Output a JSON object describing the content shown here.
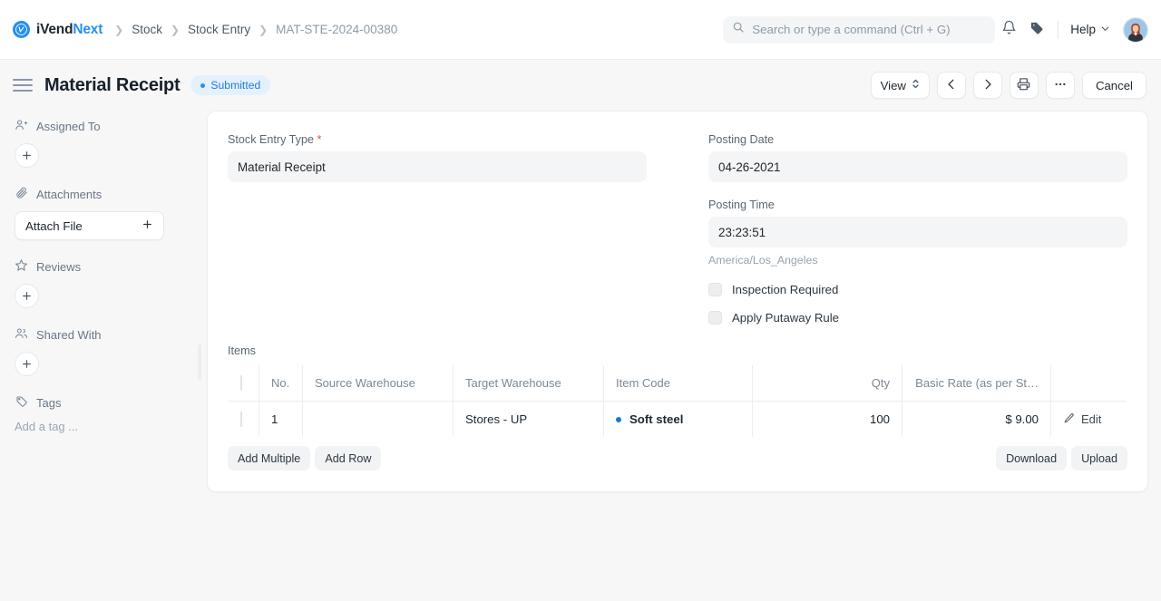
{
  "navbar": {
    "brand": {
      "part1": "iVend",
      "part2": "Next",
      "logo_icon": "ivend-logo-icon"
    },
    "breadcrumbs": [
      {
        "label": "Stock"
      },
      {
        "label": "Stock Entry"
      },
      {
        "label": "MAT-STE-2024-00380"
      }
    ],
    "search": {
      "placeholder": "Search or type a command (Ctrl + G)",
      "value": "",
      "icon": "search-icon"
    },
    "notifications_icon": "bell-icon",
    "tags_icon": "tag-icon",
    "help": {
      "label": "Help",
      "chevron": "chevron-down-icon"
    },
    "avatar_alt": "user-avatar"
  },
  "titlebar": {
    "menu_icon": "hamburger-icon",
    "title": "Material Receipt",
    "status": {
      "label": "Submitted",
      "color": "#2490ef",
      "bg": "#e5f0fd"
    },
    "actions": {
      "view_label": "View",
      "view_icon": "chevron-up-down-icon",
      "prev_icon": "chevron-left-icon",
      "next_icon": "chevron-right-icon",
      "print_icon": "printer-icon",
      "more_icon": "ellipsis-icon",
      "cancel_label": "Cancel"
    }
  },
  "sidebar": {
    "sections": [
      {
        "label": "Assigned To",
        "icon": "user-plus-icon",
        "control": "plus-circle"
      },
      {
        "label": "Attachments",
        "icon": "paperclip-icon",
        "control": "attach-button",
        "button_label": "Attach File"
      },
      {
        "label": "Reviews",
        "icon": "star-icon",
        "control": "plus-circle"
      },
      {
        "label": "Shared With",
        "icon": "users-icon",
        "control": "plus-circle"
      },
      {
        "label": "Tags",
        "icon": "tag-outline-icon",
        "control": "tag-input",
        "tag_placeholder": "Add a tag ..."
      }
    ]
  },
  "form": {
    "stock_entry_type": {
      "label": "Stock Entry Type",
      "required": true,
      "value": "Material Receipt"
    },
    "posting_date": {
      "label": "Posting Date",
      "value": "04-26-2021"
    },
    "posting_time": {
      "label": "Posting Time",
      "value": "23:23:51",
      "hint": "America/Los_Angeles"
    },
    "inspection_required": {
      "label": "Inspection Required",
      "checked": false
    },
    "apply_putaway_rule": {
      "label": "Apply Putaway Rule",
      "checked": false
    }
  },
  "items": {
    "section_label": "Items",
    "columns": [
      {
        "key": "no",
        "label": "No."
      },
      {
        "key": "source_warehouse",
        "label": "Source Warehouse"
      },
      {
        "key": "target_warehouse",
        "label": "Target Warehouse"
      },
      {
        "key": "item_code",
        "label": "Item Code"
      },
      {
        "key": "qty",
        "label": "Qty"
      },
      {
        "key": "basic_rate",
        "label": "Basic Rate (as per St…"
      },
      {
        "key": "actions",
        "label": ""
      }
    ],
    "rows": [
      {
        "no": "1",
        "source_warehouse": "",
        "target_warehouse": "Stores - UP",
        "item_code": "Soft steel",
        "qty": "100",
        "basic_rate": "$ 9.00",
        "edit_label": "Edit",
        "edit_icon": "pencil-icon"
      }
    ],
    "footer": {
      "add_multiple": "Add Multiple",
      "add_row": "Add Row",
      "download": "Download",
      "upload": "Upload"
    }
  }
}
